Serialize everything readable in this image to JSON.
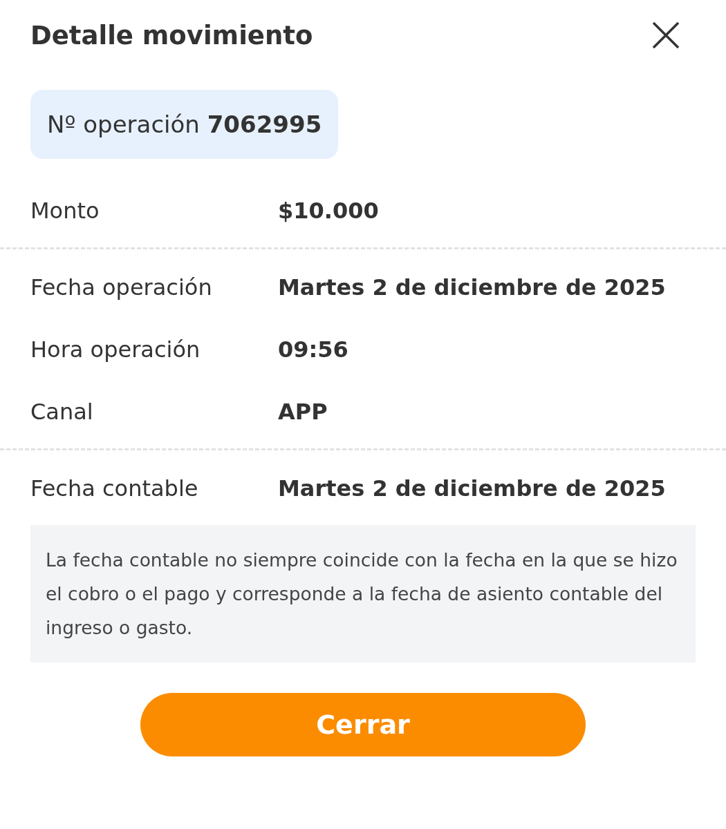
{
  "title": "Detalle movimiento",
  "operation": {
    "label": "Nº operación",
    "number": "7062995"
  },
  "sections": [
    {
      "rows": [
        {
          "label": "Monto",
          "value": "$10.000"
        }
      ]
    },
    {
      "rows": [
        {
          "label": "Fecha operación",
          "value": "Martes 2 de diciembre de 2025"
        },
        {
          "label": "Hora operación",
          "value": "09:56"
        },
        {
          "label": "Canal",
          "value": "APP"
        }
      ]
    },
    {
      "rows": [
        {
          "label": "Fecha contable",
          "value": "Martes 2 de diciembre de 2025"
        }
      ]
    }
  ],
  "note": "La fecha contable no siempre coincide con la fecha en la que se hizo el cobro o el pago y corresponde a la fecha de asiento contable del ingreso o gasto.",
  "button": "Cerrar"
}
